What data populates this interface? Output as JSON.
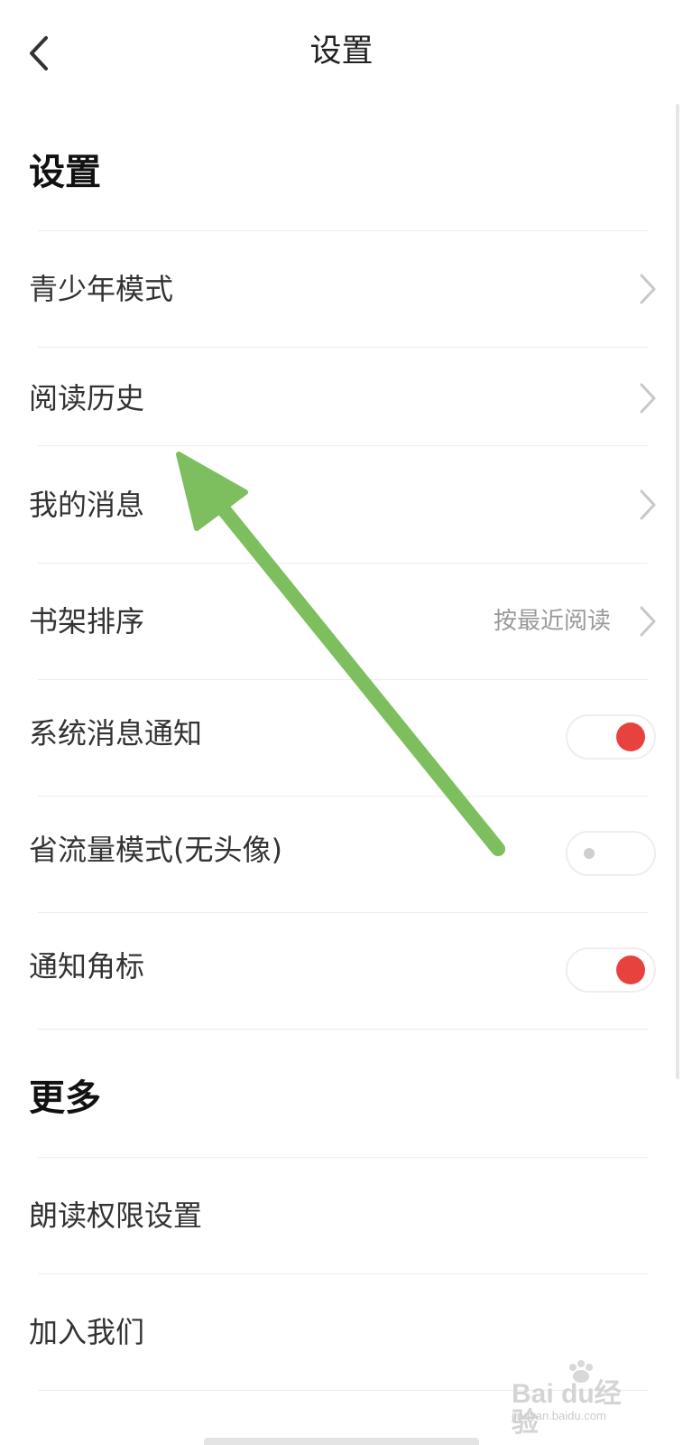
{
  "header": {
    "title": "设置",
    "back_icon": "chevron-left-icon"
  },
  "sections": [
    {
      "title": "设置",
      "items": [
        {
          "label": "青少年模式",
          "control": "chevron"
        },
        {
          "label": "阅读历史",
          "control": "chevron"
        },
        {
          "label": "我的消息",
          "control": "chevron"
        },
        {
          "label": "书架排序",
          "value": "按最近阅读",
          "control": "chevron"
        },
        {
          "label": "系统消息通知",
          "control": "toggle",
          "on": true
        },
        {
          "label": "省流量模式(无头像)",
          "control": "toggle",
          "on": false
        },
        {
          "label": "通知角标",
          "control": "toggle",
          "on": true
        }
      ]
    },
    {
      "title": "更多",
      "items": [
        {
          "label": "朗读权限设置",
          "control": "none"
        },
        {
          "label": "加入我们",
          "control": "none"
        }
      ]
    }
  ],
  "watermark": {
    "brand": "Bai du经验",
    "url": "jingyan.baidu.com"
  },
  "colors": {
    "toggle_on": "#e8423f",
    "annotation_arrow": "#7dbf5e",
    "chevron": "#c8c8c8"
  }
}
